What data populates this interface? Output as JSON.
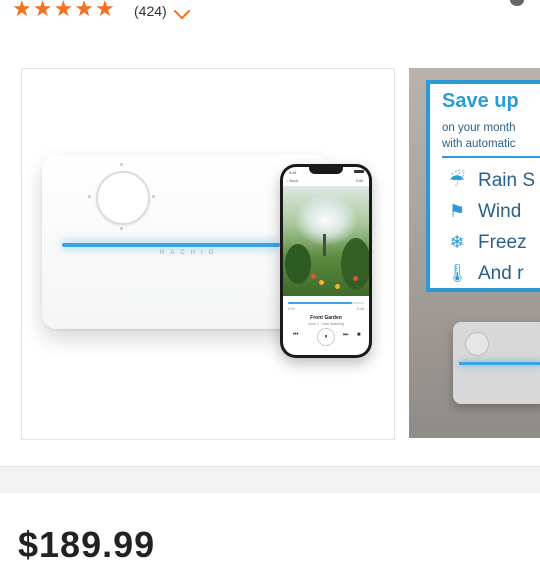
{
  "rating": {
    "stars": 5,
    "star_glyph": "★",
    "review_count": "(424)",
    "expand_icon": "chevron-down-icon"
  },
  "product_image": {
    "brand_text": "RACHIO",
    "phone": {
      "time": "9:41",
      "app_label": "‹ Back",
      "app_right": "Edit",
      "progress": 0.84,
      "elapsed": "4:02",
      "remaining": "-0:48",
      "zone_title": "Front Garden",
      "zone_sub": "Zone 1 · Now Watering",
      "prev_glyph": "⏮",
      "pause_glyph": "⏸",
      "next_glyph": "⏭",
      "stop_glyph": "■"
    }
  },
  "thumbnail": {
    "title": "Save up",
    "line1": "on your month",
    "line2": "with automatic",
    "features": [
      {
        "icon": "rain-cloud-icon",
        "glyph": "☔",
        "label": "Rain S"
      },
      {
        "icon": "wind-icon",
        "glyph": "⚑",
        "label": "Wind"
      },
      {
        "icon": "snowflake-icon",
        "glyph": "❄",
        "label": "Freez"
      },
      {
        "icon": "thermometer-icon",
        "glyph": "🌡",
        "label": "And r"
      }
    ]
  },
  "price": {
    "amount": "$189.99"
  },
  "colors": {
    "star": "#f37021",
    "accent_blue": "#2b9bd8",
    "light_bar": "#3ba4e0"
  }
}
